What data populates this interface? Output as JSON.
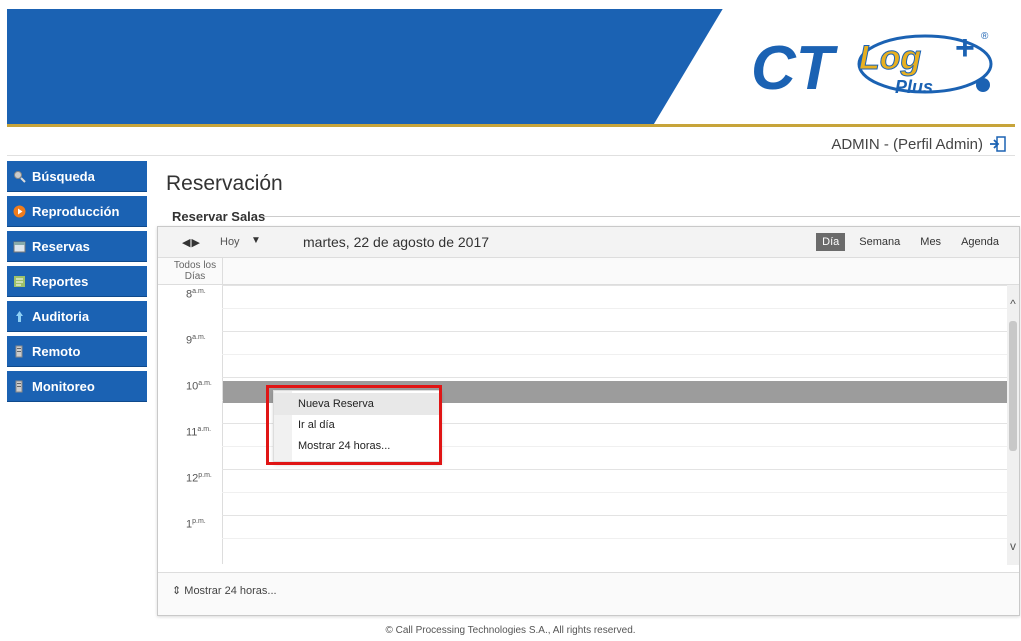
{
  "header": {
    "logo_main": "CT",
    "logo_log": "Log",
    "logo_plus": "Plus",
    "colors": {
      "brand_blue": "#1b62b3",
      "accent_gold": "#c7a43a"
    }
  },
  "user": {
    "label": "ADMIN - (Perfil Admin)"
  },
  "sidebar": {
    "items": [
      {
        "label": "Búsqueda",
        "icon": "search-icon"
      },
      {
        "label": "Reproducción",
        "icon": "play-icon"
      },
      {
        "label": "Reservas",
        "icon": "calendar-icon"
      },
      {
        "label": "Reportes",
        "icon": "report-icon"
      },
      {
        "label": "Auditoria",
        "icon": "audit-icon"
      },
      {
        "label": "Remoto",
        "icon": "remote-icon"
      },
      {
        "label": "Monitoreo",
        "icon": "monitor-icon"
      }
    ]
  },
  "page": {
    "title": "Reservación",
    "section": "Reservar Salas"
  },
  "scheduler": {
    "today": "Hoy",
    "date": "martes, 22 de agosto de 2017",
    "views": [
      "Día",
      "Semana",
      "Mes",
      "Agenda"
    ],
    "active_view": "Día",
    "allday_label": "Todos los Días",
    "hours": [
      {
        "h": "8",
        "s": "a.m."
      },
      {
        "h": "9",
        "s": "a.m."
      },
      {
        "h": "10",
        "s": "a.m."
      },
      {
        "h": "11",
        "s": "a.m."
      },
      {
        "h": "12",
        "s": "p.m."
      },
      {
        "h": "1",
        "s": "p.m."
      }
    ],
    "footer": "Mostrar 24 horas..."
  },
  "context_menu": {
    "items": [
      "Nueva Reserva",
      "Ir al día",
      "Mostrar 24 horas..."
    ]
  },
  "footer": {
    "copyright": "© Call Processing Technologies S.A., All rights reserved."
  }
}
